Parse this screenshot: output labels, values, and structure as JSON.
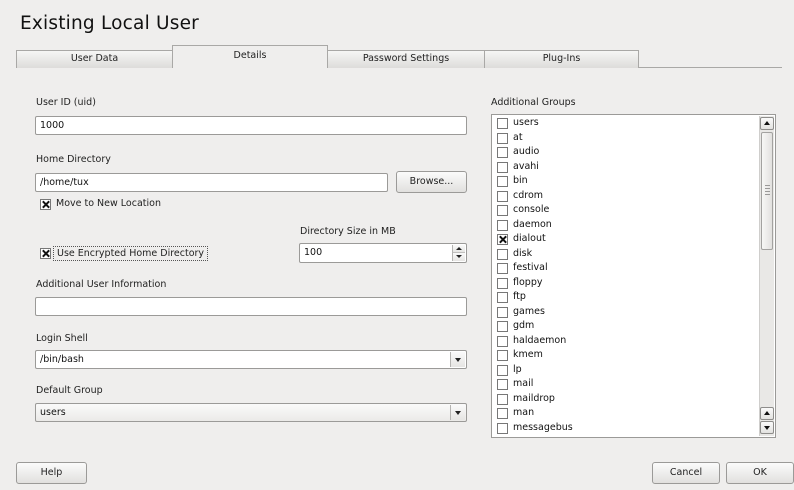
{
  "window": {
    "title": "Existing Local User"
  },
  "tabs": [
    {
      "label": "User Data"
    },
    {
      "label": "Details"
    },
    {
      "label": "Password Settings"
    },
    {
      "label": "Plug-Ins"
    }
  ],
  "form": {
    "uid": {
      "label": "User ID (uid)",
      "value": "1000"
    },
    "home": {
      "label": "Home Directory",
      "value": "/home/tux",
      "browse_label": "Browse..."
    },
    "move_location": {
      "label": "Move to New Location",
      "checked": true
    },
    "encrypted": {
      "label": "Use Encrypted Home Directory",
      "checked": true
    },
    "dir_size": {
      "label": "Directory Size in MB",
      "value": "100"
    },
    "additional_info": {
      "label": "Additional User Information",
      "value": ""
    },
    "login_shell": {
      "label": "Login Shell",
      "value": "/bin/bash"
    },
    "default_group": {
      "label": "Default Group",
      "value": "users"
    }
  },
  "groups": {
    "label": "Additional Groups",
    "items": [
      {
        "name": "users",
        "checked": false
      },
      {
        "name": "at",
        "checked": false
      },
      {
        "name": "audio",
        "checked": false
      },
      {
        "name": "avahi",
        "checked": false
      },
      {
        "name": "bin",
        "checked": false
      },
      {
        "name": "cdrom",
        "checked": false
      },
      {
        "name": "console",
        "checked": false
      },
      {
        "name": "daemon",
        "checked": false
      },
      {
        "name": "dialout",
        "checked": true
      },
      {
        "name": "disk",
        "checked": false
      },
      {
        "name": "festival",
        "checked": false
      },
      {
        "name": "floppy",
        "checked": false
      },
      {
        "name": "ftp",
        "checked": false
      },
      {
        "name": "games",
        "checked": false
      },
      {
        "name": "gdm",
        "checked": false
      },
      {
        "name": "haldaemon",
        "checked": false
      },
      {
        "name": "kmem",
        "checked": false
      },
      {
        "name": "lp",
        "checked": false
      },
      {
        "name": "mail",
        "checked": false
      },
      {
        "name": "maildrop",
        "checked": false
      },
      {
        "name": "man",
        "checked": false
      },
      {
        "name": "messagebus",
        "checked": false
      }
    ]
  },
  "footer": {
    "help_label": "Help",
    "cancel_label": "Cancel",
    "ok_label": "OK"
  }
}
